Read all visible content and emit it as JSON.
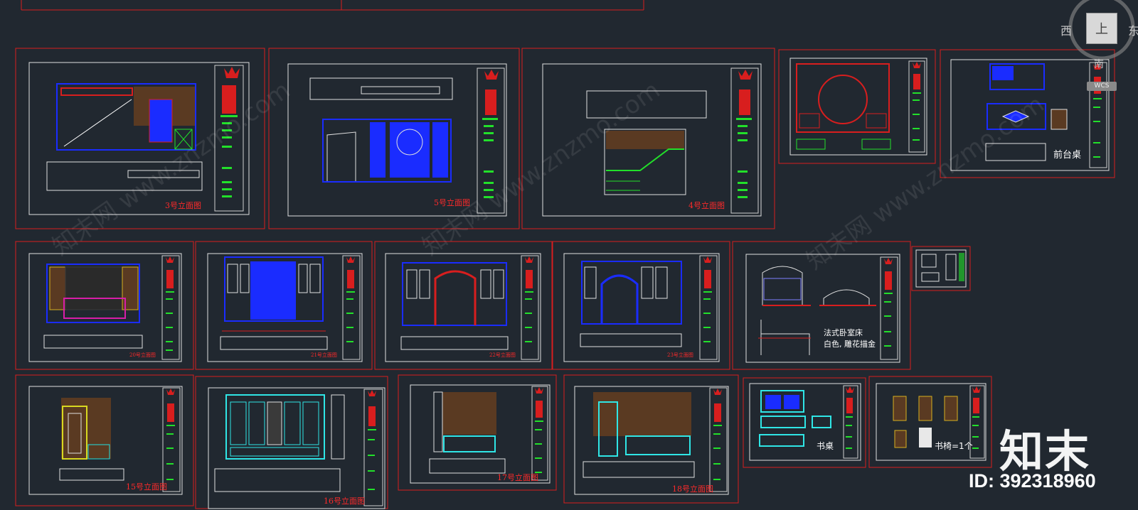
{
  "sheets": {
    "s3": "3号立面图",
    "s5": "5号立面图",
    "s4": "4号立面图",
    "s20": "20号立面图",
    "s21": "21号立面图",
    "s22": "22号立面图",
    "s23": "23号立面图",
    "s15": "15号立面图",
    "s16": "16号立面图",
    "s17": "17号立面图",
    "s18": "18号立面图"
  },
  "furniture": {
    "reception_desk": "前台桌",
    "bed_title": "法式卧室床",
    "bed_note": "白色, 雕花描金",
    "desk": "书桌",
    "chair": "书椅=1个"
  },
  "viewcube": {
    "west": "西",
    "east": "东",
    "south": "南",
    "top": "上",
    "wcs": "WCS"
  },
  "brand": {
    "name": "知末",
    "id": "ID: 392318960",
    "watermark": "知末网 www.znzmo.com"
  },
  "colors": {
    "background": "#212830",
    "frame": "#d81e1e",
    "blue": "#1a2cff",
    "green": "#22e02a",
    "cyan": "#2fe6e6",
    "brown": "#5a3a22"
  }
}
